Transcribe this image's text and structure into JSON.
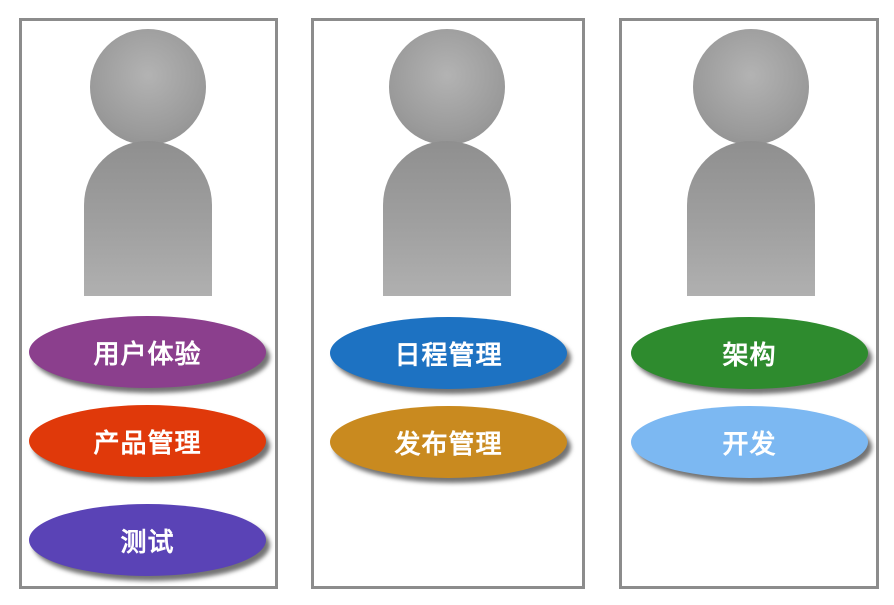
{
  "panels": [
    {
      "roles": [
        {
          "label": "用户体验",
          "color": "#8b3f8d"
        },
        {
          "label": "产品管理",
          "color": "#e0390a"
        },
        {
          "label": "测试",
          "color": "#5a43b6"
        }
      ]
    },
    {
      "roles": [
        {
          "label": "日程管理",
          "color": "#1d72c2"
        },
        {
          "label": "发布管理",
          "color": "#c98a1f"
        }
      ]
    },
    {
      "roles": [
        {
          "label": "架构",
          "color": "#2e8b2e"
        },
        {
          "label": "开发",
          "color": "#7cb8f2"
        }
      ]
    }
  ]
}
